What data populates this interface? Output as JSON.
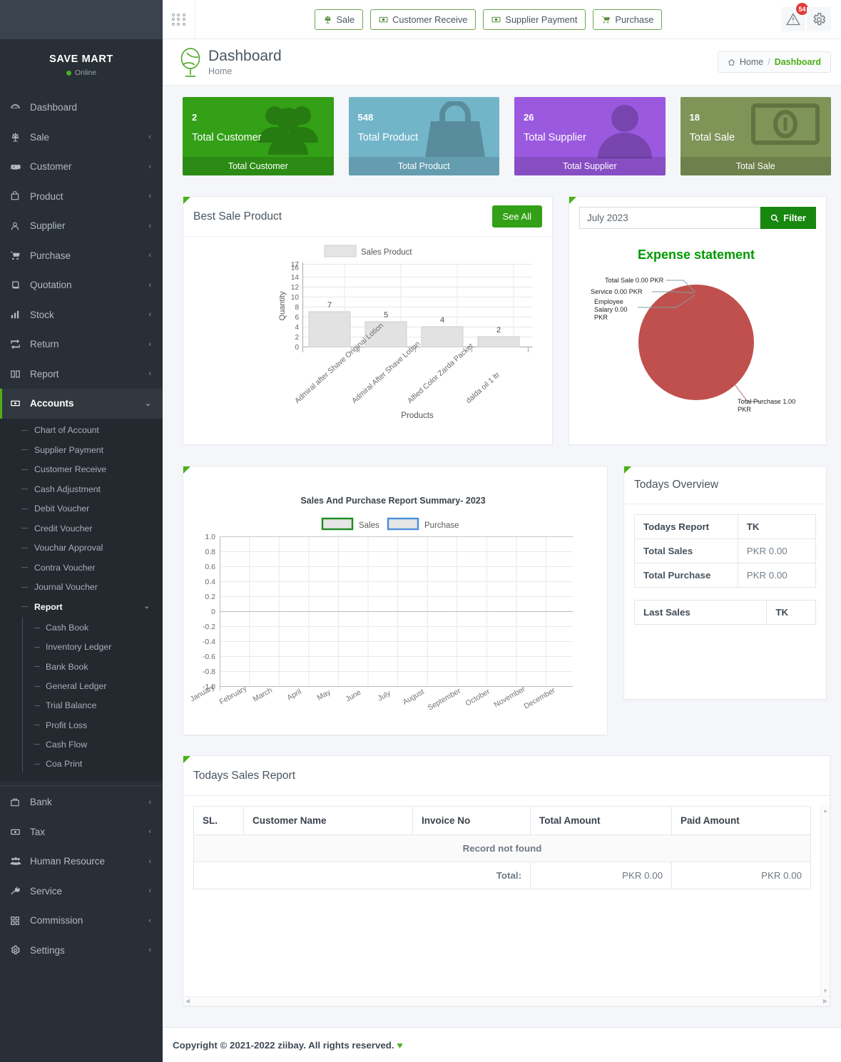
{
  "brand": {
    "name": "SAVE MART",
    "status": "Online"
  },
  "topbar": {
    "grid_icon": "grid-apps-icon",
    "actions": [
      {
        "label": "Sale",
        "icon": "scale-icon"
      },
      {
        "label": "Customer Receive",
        "icon": "money-receive-icon"
      },
      {
        "label": "Supplier Payment",
        "icon": "money-payment-icon"
      },
      {
        "label": "Purchase",
        "icon": "cart-icon"
      }
    ],
    "alert_icon": "warning-triangle-icon",
    "alert_badge": "54",
    "settings_icon": "gear-icon"
  },
  "page_header": {
    "logo_icon": "globe-icon",
    "title": "Dashboard",
    "subtitle": "Home",
    "breadcrumb": {
      "home_icon": "home-icon",
      "home": "Home",
      "sep": "/",
      "current": "Dashboard"
    }
  },
  "stats": [
    {
      "value": "2",
      "title": "Total Customer",
      "footer": "Total Customer",
      "color": "#33a017",
      "icon": "users-icon"
    },
    {
      "value": "548",
      "title": "Total Product",
      "footer": "Total Product",
      "color": "#72b5c9",
      "icon": "bag-icon"
    },
    {
      "value": "26",
      "title": "Total Supplier",
      "footer": "Total Supplier",
      "color": "#9b59e0",
      "icon": "user-icon"
    },
    {
      "value": "18",
      "title": "Total Sale",
      "footer": "Total Sale",
      "color": "#7f9457",
      "icon": "money-bill-icon"
    }
  ],
  "best_sale": {
    "title": "Best Sale Product",
    "see_all": "See All"
  },
  "expense": {
    "filter_value": "July 2023",
    "filter_placeholder": "July 2023",
    "filter_button": "Filter",
    "search_icon": "search-icon"
  },
  "todays_overview": {
    "title": "Todays Overview",
    "table": {
      "headers": [
        "Todays Report",
        "TK"
      ],
      "rows": [
        [
          "Total Sales",
          "PKR 0.00"
        ],
        [
          "Total Purchase",
          "PKR 0.00"
        ]
      ]
    },
    "last_sales": {
      "headers": [
        "Last Sales",
        "TK"
      ]
    }
  },
  "todays_sales_report": {
    "title": "Todays Sales Report",
    "headers": [
      "SL.",
      "Customer Name",
      "Invoice No",
      "Total Amount",
      "Paid Amount"
    ],
    "empty_text": "Record not found",
    "total_label": "Total:",
    "total_amount": "PKR 0.00",
    "paid_amount": "PKR 0.00"
  },
  "footer": {
    "text": "Copyright © 2021-2022 ziibay. All rights reserved.",
    "heart": "♥"
  },
  "sidebar": {
    "items": [
      {
        "label": "Dashboard",
        "icon": "speedometer-icon",
        "arrow": "",
        "active": false
      },
      {
        "label": "Sale",
        "icon": "scale-icon",
        "arrow": "‹",
        "active": false
      },
      {
        "label": "Customer",
        "icon": "handshake-icon",
        "arrow": "‹",
        "active": false
      },
      {
        "label": "Product",
        "icon": "bag-icon",
        "arrow": "‹",
        "active": false
      },
      {
        "label": "Supplier",
        "icon": "user-icon",
        "arrow": "‹",
        "active": false
      },
      {
        "label": "Purchase",
        "icon": "cart-icon",
        "arrow": "‹",
        "active": false
      },
      {
        "label": "Quotation",
        "icon": "book-icon",
        "arrow": "‹",
        "active": false
      },
      {
        "label": "Stock",
        "icon": "bar-chart-icon",
        "arrow": "‹",
        "active": false
      },
      {
        "label": "Return",
        "icon": "exchange-icon",
        "arrow": "‹",
        "active": false
      },
      {
        "label": "Report",
        "icon": "open-book-icon",
        "arrow": "‹",
        "active": false
      },
      {
        "label": "Accounts",
        "icon": "money-icon",
        "arrow": "⌄",
        "active": true
      }
    ],
    "accounts_submenu": [
      "Chart of Account",
      "Supplier Payment",
      "Customer Receive",
      "Cash Adjustment",
      "Debit Voucher",
      "Credit Voucher",
      "Vouchar Approval",
      "Contra Voucher",
      "Journal Voucher"
    ],
    "report_group": {
      "label": "Report",
      "arrow": "⌄"
    },
    "report_submenu": [
      "Cash Book",
      "Inventory Ledger",
      "Bank Book",
      "General Ledger",
      "Trial Balance",
      "Profit Loss",
      "Cash Flow",
      "Coa Print"
    ],
    "bottom_items": [
      {
        "label": "Bank",
        "icon": "briefcase-icon",
        "arrow": "‹"
      },
      {
        "label": "Tax",
        "icon": "money-icon",
        "arrow": "‹"
      },
      {
        "label": "Human Resource",
        "icon": "people-group-icon",
        "arrow": "‹"
      },
      {
        "label": "Service",
        "icon": "tools-icon",
        "arrow": "‹"
      },
      {
        "label": "Commission",
        "icon": "squares-icon",
        "arrow": "‹"
      },
      {
        "label": "Settings",
        "icon": "gear-icon",
        "arrow": "‹"
      }
    ]
  },
  "chart_data": [
    {
      "type": "bar",
      "title": "",
      "legend": [
        "Sales Product"
      ],
      "legend_position": "top",
      "xlabel": "Products",
      "ylabel": "Quantity",
      "categories": [
        "Admiral after Shave  Original Lotion",
        "Admiral After Shave Lotion",
        "Alfied Color Zarda Packet",
        "dalda oil 1 ltr"
      ],
      "values": [
        7,
        5,
        4,
        2
      ],
      "data_labels": [
        "7",
        "5",
        "4",
        "2"
      ],
      "yticks": [
        0,
        2,
        4,
        6,
        8,
        10,
        12,
        14,
        16,
        17
      ],
      "ytick_labels": [
        "0",
        "2",
        "4",
        "6",
        "8",
        "10",
        "12",
        "14",
        "16",
        "17"
      ],
      "ylim": [
        0,
        17
      ],
      "grid": true,
      "bar_color": "#e0e0e0",
      "bar_edge": "#c9c9c9"
    },
    {
      "type": "pie",
      "title": "Expense statement",
      "title_color": "#009900",
      "labels": [
        "Total Sale 0.00 PKR",
        "Service  0.00 PKR",
        "Employee Salary 0.00 PKR",
        "Total Purchase 1.00 PKR"
      ],
      "values": [
        0,
        0,
        0,
        1
      ],
      "slice_colors": [
        "#c0504d",
        "#c0504d",
        "#c0504d",
        "#c0504d"
      ],
      "legend_position": "callouts"
    },
    {
      "type": "line",
      "title": "Sales And Purchase Report Summary- 2023",
      "legend": [
        "Sales",
        "Purchase"
      ],
      "legend_colors": [
        "#1e8b1e",
        "#4a90d9"
      ],
      "legend_position": "top",
      "x": [
        "January",
        "February",
        "March",
        "April",
        "May",
        "June",
        "July",
        "August",
        "September",
        "October",
        "November",
        "December"
      ],
      "series": [
        {
          "name": "Sales",
          "values": [
            null,
            null,
            null,
            null,
            null,
            null,
            null,
            null,
            null,
            null,
            null,
            null
          ]
        },
        {
          "name": "Purchase",
          "values": [
            null,
            null,
            null,
            null,
            null,
            null,
            null,
            null,
            null,
            null,
            null,
            null
          ]
        }
      ],
      "yticks": [
        -1.0,
        -0.8,
        -0.6,
        -0.4,
        -0.2,
        0,
        0.2,
        0.4,
        0.6,
        0.8,
        1.0
      ],
      "ytick_labels": [
        "-1.0",
        "-0.8",
        "-0.6",
        "-0.4",
        "-0.2",
        "0",
        "0.2",
        "0.4",
        "0.6",
        "0.8",
        "1.0"
      ],
      "ylim": [
        -1.0,
        1.0
      ],
      "xlabel": "",
      "ylabel": "",
      "grid": true
    }
  ]
}
